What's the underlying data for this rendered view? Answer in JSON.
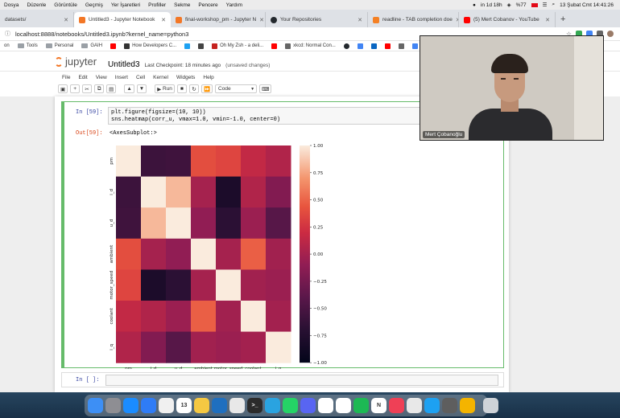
{
  "menubar": {
    "items": [
      "Dosya",
      "Düzenle",
      "Görüntüle",
      "Geçmiş",
      "Yer İşaretleri",
      "Profiller",
      "Sekme",
      "Pencere",
      "Yardım"
    ],
    "status_timer": "in 1d 18h",
    "battery": "%77",
    "datetime": "13 Şubat Cmt  14:41:26"
  },
  "tabs": [
    {
      "label": "datasets/",
      "fav": "#888888"
    },
    {
      "label": "Untitled3 - Jupyter Notebook",
      "fav": "#f37726",
      "active": true
    },
    {
      "label": "final-workshop_pm - Jupyter N",
      "fav": "#f37726"
    },
    {
      "label": "Your Repositories",
      "fav": "#24292e"
    },
    {
      "label": "readline - TAB completion doe",
      "fav": "#f48024"
    },
    {
      "label": "(5) Mert Cobanov - YouTube",
      "fav": "#ff0000"
    }
  ],
  "address": {
    "url": "localhost:8888/notebooks/Untitled3.ipynb?kernel_name=python3"
  },
  "bookmarks": [
    {
      "label": "on",
      "type": "text"
    },
    {
      "label": "Tools",
      "type": "folder"
    },
    {
      "label": "Personal",
      "type": "folder"
    },
    {
      "label": "GAIH",
      "type": "folder"
    },
    {
      "label": "",
      "type": "icon",
      "color": "#ff0000"
    },
    {
      "label": "How Developers C...",
      "type": "icon",
      "color": "#333333"
    },
    {
      "label": "",
      "type": "icon",
      "color": "#1da1f2"
    },
    {
      "label": "",
      "type": "icon",
      "color": "#444444"
    },
    {
      "label": "Oh My Zsh - a deli...",
      "type": "icon",
      "color": "#c5221f"
    },
    {
      "label": "",
      "type": "icon",
      "color": "#ff0000"
    },
    {
      "label": "xkcd: Normal Con...",
      "type": "icon",
      "color": "#666666"
    },
    {
      "label": "",
      "type": "icon",
      "color": "#24292e"
    },
    {
      "label": "",
      "type": "icon",
      "color": "#4285f4"
    },
    {
      "label": "",
      "type": "icon",
      "color": "#0a66c2"
    },
    {
      "label": "",
      "type": "icon",
      "color": "#ff0000"
    },
    {
      "label": "",
      "type": "icon",
      "color": "#666666"
    },
    {
      "label": "",
      "type": "icon",
      "color": "#4285f4"
    },
    {
      "label": "Fu",
      "type": "icon",
      "color": "#555555"
    }
  ],
  "jupyter": {
    "logo": "jupyter",
    "notebook_title": "Untitled3",
    "checkpoint": "Last Checkpoint: 18 minutes ago",
    "unsaved": "(unsaved changes)",
    "menu": [
      "File",
      "Edit",
      "View",
      "Insert",
      "Cell",
      "Kernel",
      "Widgets",
      "Help"
    ],
    "toolbar": {
      "run_label": "Run",
      "cell_type": "Code"
    },
    "cell1": {
      "prompt_in": "In [59]:",
      "code_line1": "plt.figure(figsize=(10, 10))",
      "code_line2": "sns.heatmap(corr_u, vmax=1.0, vmin=-1.0, center=0)",
      "prompt_out": "Out[59]:",
      "output_text": "<AxesSubplot:>"
    },
    "cell2": {
      "prompt_in": "In [ ]:"
    }
  },
  "chart_data": {
    "type": "heatmap",
    "rows": [
      "pm",
      "i_d",
      "u_d",
      "ambient",
      "motor_speed",
      "coolant",
      "i_q"
    ],
    "columns": [
      "pm",
      "i_d",
      "u_d",
      "ambient",
      "motor_speed",
      "coolant",
      "i_q"
    ],
    "values": [
      [
        1.0,
        -0.58,
        -0.56,
        0.4,
        0.35,
        0.15,
        0.06
      ],
      [
        -0.58,
        1.0,
        0.82,
        0.0,
        -0.8,
        0.06,
        -0.18
      ],
      [
        -0.56,
        0.82,
        1.0,
        -0.1,
        -0.68,
        -0.05,
        -0.42
      ],
      [
        0.4,
        0.0,
        -0.1,
        1.0,
        0.0,
        0.48,
        -0.02
      ],
      [
        0.35,
        -0.8,
        -0.68,
        0.0,
        1.0,
        -0.02,
        -0.05
      ],
      [
        0.15,
        0.06,
        -0.05,
        0.48,
        -0.02,
        1.0,
        -0.01
      ],
      [
        0.06,
        -0.18,
        -0.42,
        -0.02,
        -0.05,
        -0.01,
        1.0
      ]
    ],
    "vmin": -1.0,
    "vmax": 1.0,
    "center": 0,
    "colorbar_ticks": [
      1.0,
      0.75,
      0.5,
      0.25,
      0.0,
      -0.25,
      -0.5,
      -0.75,
      -1.0
    ],
    "colorbar_labels": [
      "1.00",
      "0.75",
      "0.50",
      "0.25",
      "0.00",
      "−0.25",
      "−0.50",
      "−0.75",
      "−1.00"
    ]
  },
  "webcam": {
    "name": "Mert Çobanoğlu"
  },
  "dock": {
    "apps": [
      {
        "name": "finder",
        "color": "#3d8ff5",
        "glyph": ""
      },
      {
        "name": "launchpad",
        "color": "#8e8e93",
        "glyph": ""
      },
      {
        "name": "safari",
        "color": "#1a8cff",
        "glyph": ""
      },
      {
        "name": "mail",
        "color": "#2f7cf6",
        "glyph": ""
      },
      {
        "name": "photos",
        "color": "#f0f0f0",
        "glyph": ""
      },
      {
        "name": "calendar",
        "color": "#ffffff",
        "glyph": "13"
      },
      {
        "name": "notes",
        "color": "#f5c842",
        "glyph": ""
      },
      {
        "name": "vscode",
        "color": "#1f6fbf",
        "glyph": ""
      },
      {
        "name": "finder2",
        "color": "#e8e8e8",
        "glyph": ""
      },
      {
        "name": "terminal",
        "color": "#2b2b2b",
        "glyph": ">_"
      },
      {
        "name": "telegram",
        "color": "#2aa3e0",
        "glyph": ""
      },
      {
        "name": "whatsapp",
        "color": "#25d366",
        "glyph": ""
      },
      {
        "name": "discord",
        "color": "#5865f2",
        "glyph": ""
      },
      {
        "name": "slack",
        "color": "#ffffff",
        "glyph": ""
      },
      {
        "name": "chrome",
        "color": "#ffffff",
        "glyph": ""
      },
      {
        "name": "spotify",
        "color": "#1db954",
        "glyph": ""
      },
      {
        "name": "notion",
        "color": "#ffffff",
        "glyph": "N"
      },
      {
        "name": "pocket",
        "color": "#ef4056",
        "glyph": ""
      },
      {
        "name": "mail2",
        "color": "#e8e8e8",
        "glyph": ""
      },
      {
        "name": "twitter",
        "color": "#1da1f2",
        "glyph": ""
      },
      {
        "name": "preview",
        "color": "#5e5e5e",
        "glyph": ""
      },
      {
        "name": "chrome-canary",
        "color": "#f4b400",
        "glyph": ""
      },
      {
        "name": "trash",
        "color": "#cfd3d8",
        "glyph": ""
      }
    ]
  }
}
